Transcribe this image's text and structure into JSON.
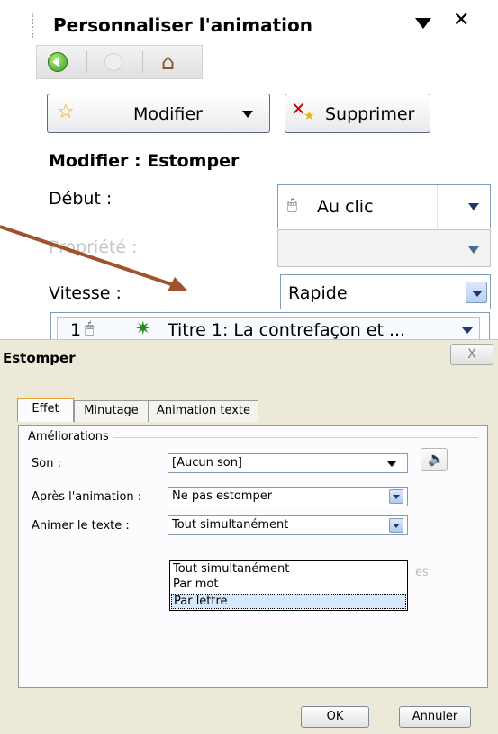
{
  "pane": {
    "title": "Personnaliser l'animation",
    "modify_label": "Modifier",
    "delete_label": "Supprimer",
    "section_title": "Modifier : Estomper",
    "start_label": "Début :",
    "start_value": "Au clic",
    "property_label": "Propriété :",
    "speed_label": "Vitesse :",
    "speed_value": "Rapide",
    "effect_number": "1",
    "effect_text": "Titre 1: La contrefaçon et ..."
  },
  "dialog": {
    "title": "Estomper",
    "close_label": "X",
    "tabs": [
      {
        "label": "Effet"
      },
      {
        "label": "Minutage"
      },
      {
        "label": "Animation texte"
      }
    ],
    "group_label": "Améliorations",
    "sound_label": "Son :",
    "sound_value": "[Aucun son]",
    "after_label": "Après l'animation :",
    "after_value": "Ne pas estomper",
    "animate_label": "Animer le texte :",
    "animate_value": "Tout simultanément",
    "animate_options": [
      "Tout simultanément",
      "Par mot",
      "Par lettre"
    ],
    "ghost_text": "es",
    "ok_label": "OK",
    "cancel_label": "Annuler"
  },
  "colors": {
    "arrow": "#a0522d",
    "dialog_bg": "#ece9d8",
    "selected_option_bg": "#d6e8fb"
  }
}
